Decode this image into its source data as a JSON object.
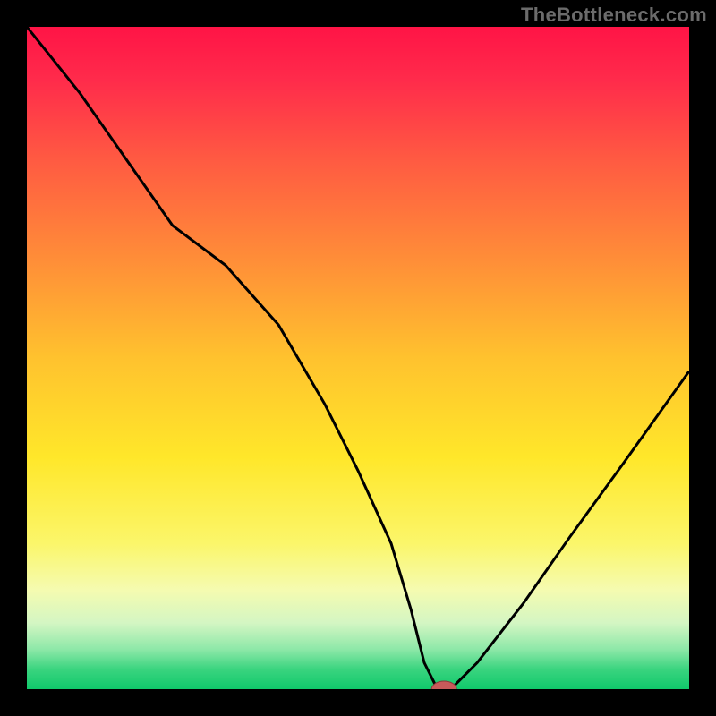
{
  "watermark": "TheBottleneck.com",
  "chart_data": {
    "type": "line",
    "title": "",
    "xlabel": "",
    "ylabel": "",
    "x_range": [
      0,
      100
    ],
    "y_range": [
      0,
      100
    ],
    "series": [
      {
        "name": "curve",
        "x": [
          0,
          8,
          15,
          22,
          30,
          38,
          45,
          50,
          55,
          58,
          60,
          62,
          64,
          68,
          75,
          82,
          90,
          100
        ],
        "y": [
          100,
          90,
          80,
          70,
          64,
          55,
          43,
          33,
          22,
          12,
          4,
          0,
          0,
          4,
          13,
          23,
          34,
          48
        ]
      }
    ],
    "marker": {
      "x": 63,
      "y": 0
    },
    "gradient_stops": [
      {
        "offset": 0.0,
        "color": "#ff1446"
      },
      {
        "offset": 0.08,
        "color": "#ff2b4b"
      },
      {
        "offset": 0.2,
        "color": "#ff5a42"
      },
      {
        "offset": 0.35,
        "color": "#ff8d38"
      },
      {
        "offset": 0.5,
        "color": "#ffc22e"
      },
      {
        "offset": 0.65,
        "color": "#ffe72a"
      },
      {
        "offset": 0.78,
        "color": "#fbf66a"
      },
      {
        "offset": 0.85,
        "color": "#f5fbb0"
      },
      {
        "offset": 0.9,
        "color": "#d4f6c3"
      },
      {
        "offset": 0.94,
        "color": "#8de8a8"
      },
      {
        "offset": 0.97,
        "color": "#3ad47f"
      },
      {
        "offset": 1.0,
        "color": "#10c96b"
      }
    ],
    "colors": {
      "curve": "#000000",
      "marker_fill": "#c85a5a",
      "marker_stroke": "#8a3c3c",
      "frame": "#000000"
    }
  }
}
